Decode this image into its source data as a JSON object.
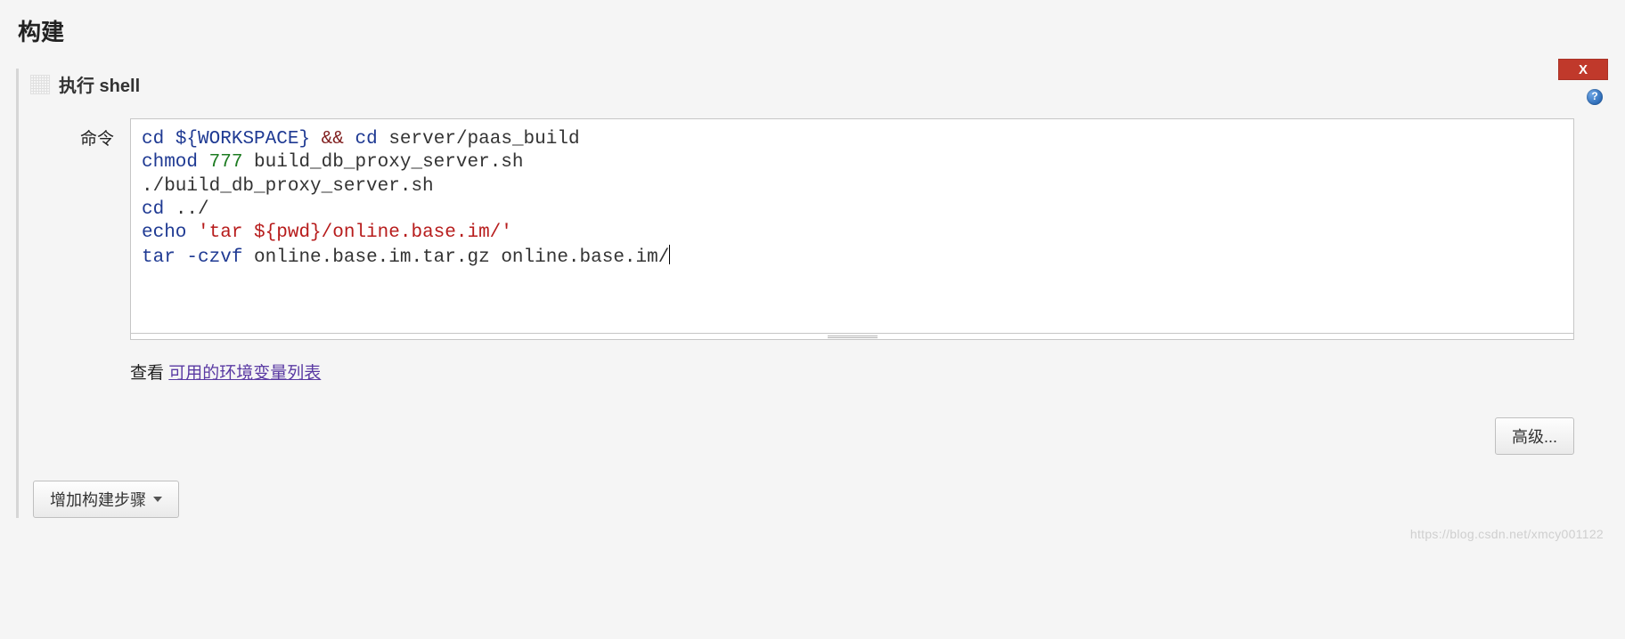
{
  "section": {
    "title": "构建"
  },
  "block": {
    "title": "执行 shell",
    "close_label": "X",
    "command_label": "命令",
    "hint_prefix": "查看 ",
    "hint_link": "可用的环境变量列表",
    "advanced_label": "高级...",
    "code": {
      "l1": {
        "cmd1": "cd",
        "var1": "${WORKSPACE}",
        "op": "&&",
        "cmd2": "cd",
        "arg2": "server/paas_build"
      },
      "l2": {
        "cmd": "chmod",
        "num": "777",
        "arg": "build_db_proxy_server.sh"
      },
      "l3": {
        "text": "./build_db_proxy_server.sh"
      },
      "l4": {
        "cmd": "cd",
        "arg": "../"
      },
      "l5": {
        "cmd": "echo",
        "str": "'tar ${pwd}/online.base.im/'"
      },
      "l6": {
        "cmd": "tar",
        "opt": "-czvf",
        "arg1": "online.base.im.tar.gz",
        "arg2": "online.base.im/"
      }
    }
  },
  "add_step_label": "增加构建步骤",
  "watermark": "https://blog.csdn.net/xmcy001122"
}
